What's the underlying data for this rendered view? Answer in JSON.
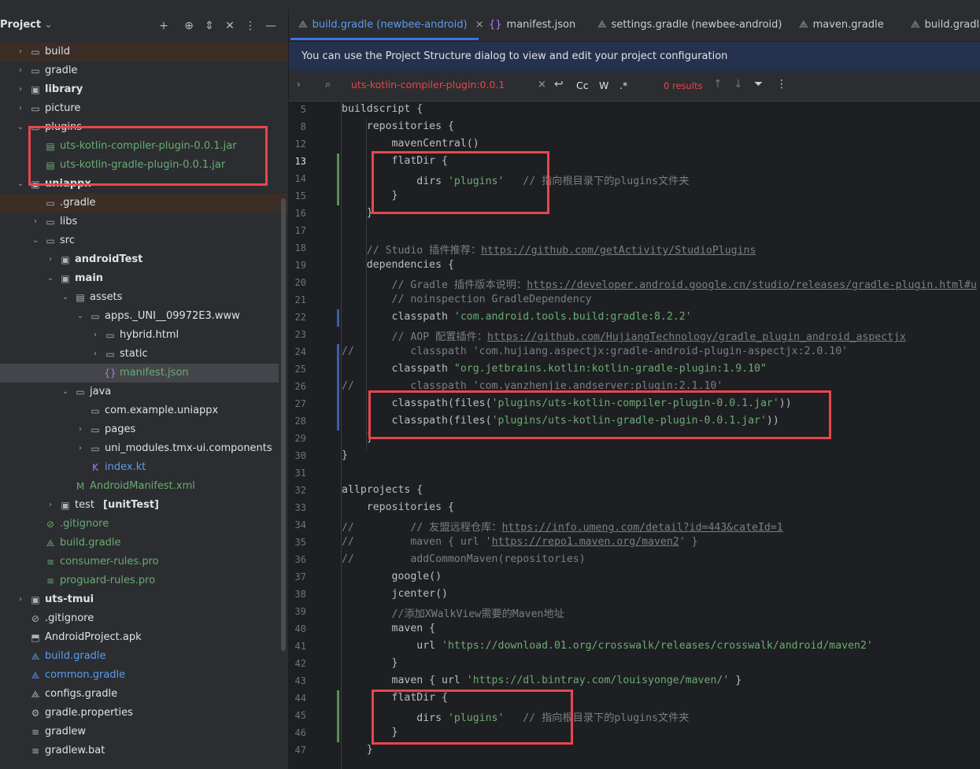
{
  "project_panel": {
    "title": "Project",
    "tree": [
      {
        "label": "build",
        "indent": 0,
        "arrow": "right",
        "icon": "folder-icon",
        "bold": false,
        "style": "orange-hl"
      },
      {
        "label": "gradle",
        "indent": 0,
        "arrow": "right",
        "icon": "folder-icon"
      },
      {
        "label": "library",
        "indent": 0,
        "arrow": "right",
        "icon": "module-folder-icon",
        "bold": true
      },
      {
        "label": "picture",
        "indent": 0,
        "arrow": "right",
        "icon": "folder-icon"
      },
      {
        "label": "plugins",
        "indent": 0,
        "arrow": "down",
        "icon": "folder-icon"
      },
      {
        "label": "uts-kotlin-compiler-plugin-0.0.1.jar",
        "indent": 1,
        "icon": "jar-icon",
        "color": "green"
      },
      {
        "label": "uts-kotlin-gradle-plugin-0.0.1.jar",
        "indent": 1,
        "icon": "jar-icon",
        "color": "green"
      },
      {
        "label": "uniappx",
        "indent": 0,
        "arrow": "down",
        "icon": "module-folder-icon",
        "bold": true
      },
      {
        "label": ".gradle",
        "indent": 1,
        "icon": "folder-icon",
        "style": "orange-hl"
      },
      {
        "label": "libs",
        "indent": 1,
        "arrow": "right",
        "icon": "folder-icon"
      },
      {
        "label": "src",
        "indent": 1,
        "arrow": "down",
        "icon": "folder-icon"
      },
      {
        "label": "androidTest",
        "indent": 2,
        "arrow": "right",
        "icon": "source-folder-icon",
        "bold": true
      },
      {
        "label": "main",
        "indent": 2,
        "arrow": "down",
        "icon": "source-folder-icon",
        "bold": true
      },
      {
        "label": "assets",
        "indent": 3,
        "arrow": "down",
        "icon": "resource-folder-icon"
      },
      {
        "label": "apps._UNI__09972E3.www",
        "indent": 4,
        "arrow": "down",
        "icon": "folder-icon"
      },
      {
        "label": "hybrid.html",
        "indent": 5,
        "arrow": "right",
        "icon": "folder-icon"
      },
      {
        "label": "static",
        "indent": 5,
        "arrow": "right",
        "icon": "folder-icon"
      },
      {
        "label": "manifest.json",
        "indent": 5,
        "icon": "json-icon",
        "color": "green",
        "selected": true
      },
      {
        "label": "java",
        "indent": 3,
        "arrow": "down",
        "icon": "java-folder-icon"
      },
      {
        "label": "com.example.uniappx",
        "indent": 4,
        "icon": "package-icon"
      },
      {
        "label": "pages",
        "indent": 4,
        "arrow": "right",
        "icon": "package-icon"
      },
      {
        "label": "uni_modules.tmx-ui.components",
        "indent": 4,
        "arrow": "right",
        "icon": "package-icon"
      },
      {
        "label": "index.kt",
        "indent": 4,
        "icon": "kotlin-icon",
        "color": "blue"
      },
      {
        "label": "AndroidManifest.xml",
        "indent": 3,
        "icon": "manifest-icon",
        "color": "green"
      },
      {
        "label": "test",
        "suffix": "[unitTest]",
        "indent": 2,
        "arrow": "right",
        "icon": "test-folder-icon"
      },
      {
        "label": ".gitignore",
        "indent": 1,
        "icon": "gitignore-icon",
        "color": "green"
      },
      {
        "label": "build.gradle",
        "indent": 1,
        "icon": "gradle-icon",
        "color": "green"
      },
      {
        "label": "consumer-rules.pro",
        "indent": 1,
        "icon": "text-file-icon",
        "color": "green"
      },
      {
        "label": "proguard-rules.pro",
        "indent": 1,
        "icon": "text-file-icon",
        "color": "green"
      },
      {
        "label": "uts-tmui",
        "indent": 0,
        "arrow": "right",
        "icon": "module-folder-icon",
        "bold": true
      },
      {
        "label": ".gitignore",
        "indent": 0,
        "icon": "gitignore-icon"
      },
      {
        "label": "AndroidProject.apk",
        "indent": 0,
        "icon": "apk-icon"
      },
      {
        "label": "build.gradle",
        "indent": 0,
        "icon": "gradle-icon",
        "color": "blue"
      },
      {
        "label": "common.gradle",
        "indent": 0,
        "icon": "gradle-icon",
        "color": "blue"
      },
      {
        "label": "configs.gradle",
        "indent": 0,
        "icon": "gradle-icon"
      },
      {
        "label": "gradle.properties",
        "indent": 0,
        "icon": "settings-file-icon"
      },
      {
        "label": "gradlew",
        "indent": 0,
        "icon": "text-file-icon"
      },
      {
        "label": "gradlew.bat",
        "indent": 0,
        "icon": "text-file-icon"
      }
    ]
  },
  "tabs": [
    {
      "label": "build.gradle (newbee-android)",
      "icon": "gradle-icon",
      "active": true,
      "closable": true
    },
    {
      "label": "manifest.json",
      "icon": "json-icon"
    },
    {
      "label": "settings.gradle (newbee-android)",
      "icon": "gradle-icon"
    },
    {
      "label": "maven.gradle",
      "icon": "gradle-icon"
    },
    {
      "label": "build.gradle",
      "icon": "gradle-icon"
    }
  ],
  "banner": "You can use the Project Structure dialog to view and edit your project configuration",
  "find": {
    "query": "uts-kotlin-compiler-plugin:0.0.1",
    "results": "0 results",
    "case_label": "Cc",
    "word_label": "W",
    "regex_label": ".*"
  },
  "code_lines": [
    {
      "n": "5",
      "segs": [
        [
          "fn",
          "buildscript {"
        ]
      ]
    },
    {
      "n": "8",
      "segs": [
        [
          "fn",
          "    repositories {"
        ]
      ]
    },
    {
      "n": "12",
      "segs": [
        [
          "fn",
          "        mavenCentral()"
        ]
      ]
    },
    {
      "n": "13",
      "cur": true,
      "segs": [
        [
          "fn",
          "        flatDir {"
        ]
      ]
    },
    {
      "n": "14",
      "segs": [
        [
          "fn",
          "            dirs "
        ],
        [
          "str",
          "'plugins'"
        ],
        [
          "cm",
          "   // 指向根目录下的plugins文件夹"
        ]
      ]
    },
    {
      "n": "15",
      "segs": [
        [
          "fn",
          "        }"
        ]
      ]
    },
    {
      "n": "16",
      "segs": [
        [
          "fn",
          "    }"
        ]
      ]
    },
    {
      "n": "17",
      "segs": []
    },
    {
      "n": "18",
      "segs": [
        [
          "cm",
          "    // Studio 插件推荐："
        ],
        [
          "url",
          "https://github.com/getActivity/StudioPlugins"
        ]
      ]
    },
    {
      "n": "19",
      "segs": [
        [
          "fn",
          "    dependencies {"
        ]
      ]
    },
    {
      "n": "20",
      "segs": [
        [
          "cm",
          "        // Gradle 插件版本说明："
        ],
        [
          "url",
          "https://developer.android.google.cn/studio/releases/gradle-plugin.html#u"
        ]
      ]
    },
    {
      "n": "21",
      "segs": [
        [
          "cm",
          "        // noinspection GradleDependency"
        ]
      ]
    },
    {
      "n": "22",
      "segs": [
        [
          "fn",
          "        classpath "
        ],
        [
          "str",
          "'com.android.tools.build:gradle:8.2.2'"
        ]
      ]
    },
    {
      "n": "23",
      "segs": [
        [
          "cm",
          "        // AOP 配置插件："
        ],
        [
          "url",
          "https://github.com/HujiangTechnology/gradle_plugin_android_aspectjx"
        ]
      ]
    },
    {
      "n": "24",
      "segs": [
        [
          "cm",
          "//         classpath 'com.hujiang.aspectjx:gradle-android-plugin-aspectjx:2.0.10'"
        ]
      ]
    },
    {
      "n": "25",
      "segs": [
        [
          "fn",
          "        classpath "
        ],
        [
          "str",
          "\"org.jetbrains.kotlin:kotlin-gradle-plugin:1.9.10\""
        ]
      ]
    },
    {
      "n": "26",
      "segs": [
        [
          "cm",
          "//         classpath 'com.yanzhenjie.andserver:plugin:2.1.10'"
        ]
      ]
    },
    {
      "n": "27",
      "segs": [
        [
          "fn",
          "        classpath(files("
        ],
        [
          "str",
          "'plugins/uts-kotlin-compiler-plugin-0.0.1.jar'"
        ],
        [
          "fn",
          "))"
        ]
      ]
    },
    {
      "n": "28",
      "segs": [
        [
          "fn",
          "        classpath(files("
        ],
        [
          "str",
          "'plugins/uts-kotlin-gradle-plugin-0.0.1.jar'"
        ],
        [
          "fn",
          "))"
        ]
      ]
    },
    {
      "n": "29",
      "segs": [
        [
          "fn",
          "    }"
        ]
      ]
    },
    {
      "n": "30",
      "segs": [
        [
          "fn",
          "}"
        ]
      ]
    },
    {
      "n": "31",
      "segs": []
    },
    {
      "n": "32",
      "segs": [
        [
          "fn",
          "allprojects {"
        ]
      ]
    },
    {
      "n": "33",
      "segs": [
        [
          "fn",
          "    repositories {"
        ]
      ]
    },
    {
      "n": "34",
      "segs": [
        [
          "cm",
          "//         // 友盟远程仓库："
        ],
        [
          "url",
          "https://info.umeng.com/detail?id=443&cateId=1"
        ]
      ]
    },
    {
      "n": "35",
      "segs": [
        [
          "cm",
          "//         maven { url '"
        ],
        [
          "url",
          "https://repo1.maven.org/maven2"
        ],
        [
          "cm",
          "' }"
        ]
      ]
    },
    {
      "n": "36",
      "segs": [
        [
          "cm",
          "//         addCommonMaven(repositories)"
        ]
      ]
    },
    {
      "n": "37",
      "segs": [
        [
          "fn",
          "        google()"
        ]
      ]
    },
    {
      "n": "38",
      "segs": [
        [
          "fn",
          "        jcenter()"
        ]
      ]
    },
    {
      "n": "39",
      "segs": [
        [
          "cm",
          "        //添加XWalkView需要的Maven地址"
        ]
      ]
    },
    {
      "n": "40",
      "segs": [
        [
          "fn",
          "        maven {"
        ]
      ]
    },
    {
      "n": "41",
      "segs": [
        [
          "fn",
          "            url "
        ],
        [
          "str",
          "'https://download.01.org/crosswalk/releases/crosswalk/android/maven2'"
        ]
      ]
    },
    {
      "n": "42",
      "segs": [
        [
          "fn",
          "        }"
        ]
      ]
    },
    {
      "n": "43",
      "segs": [
        [
          "fn",
          "        maven { url "
        ],
        [
          "str",
          "'https://dl.bintray.com/louisyonge/maven/'"
        ],
        [
          "fn",
          " }"
        ]
      ]
    },
    {
      "n": "44",
      "segs": [
        [
          "fn",
          "        flatDir {"
        ]
      ]
    },
    {
      "n": "45",
      "segs": [
        [
          "fn",
          "            dirs "
        ],
        [
          "str",
          "'plugins'"
        ],
        [
          "cm",
          "   // 指向根目录下的plugins文件夹"
        ]
      ]
    },
    {
      "n": "46",
      "segs": [
        [
          "fn",
          "        }"
        ]
      ]
    },
    {
      "n": "47",
      "segs": [
        [
          "fn",
          "    }"
        ]
      ]
    }
  ],
  "colors": {
    "accent": "#3574f0",
    "annotation_box": "#e8464d",
    "string": "#6aab73",
    "comment": "#7a7e85"
  }
}
